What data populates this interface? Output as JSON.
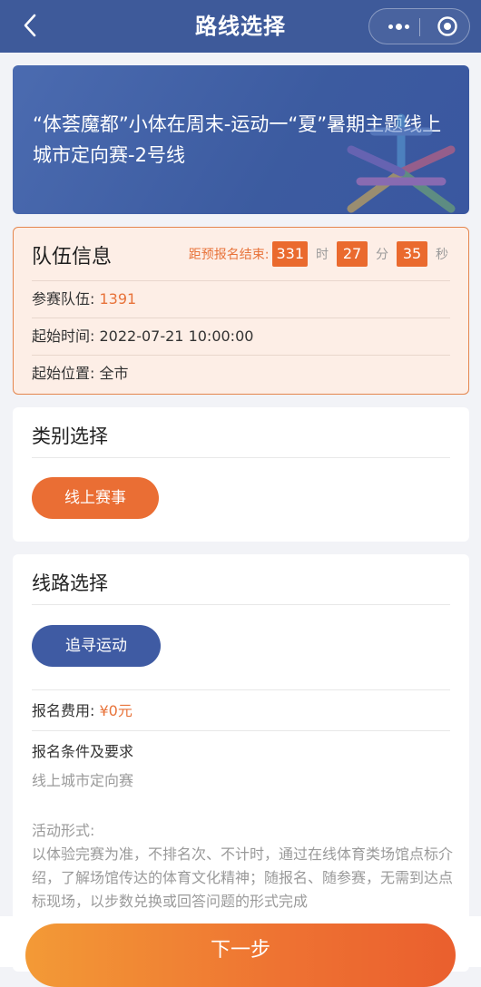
{
  "header": {
    "title": "路线选择"
  },
  "banner": {
    "title": "“体荟魔都”小体在周末-运动一“夏”暑期主题线上城市定向赛-2号线"
  },
  "team": {
    "title": "队伍信息",
    "countdown": {
      "label": "距预报名结束:",
      "hours": "331",
      "hours_unit": "时",
      "minutes": "27",
      "minutes_unit": "分",
      "seconds": "35",
      "seconds_unit": "秒"
    },
    "rows": [
      {
        "label": "参赛队伍:",
        "value": "1391"
      },
      {
        "label": "起始时间:",
        "value": "2022-07-21 10:00:00"
      },
      {
        "label": "起始位置:",
        "value": "全市"
      }
    ]
  },
  "category": {
    "title": "类别选择",
    "option": "线上赛事"
  },
  "route": {
    "title": "线路选择",
    "option": "追寻运动",
    "fee_label": "报名费用:",
    "fee_value": "¥0元",
    "req_title": "报名条件及要求",
    "req_text": "线上城市定向赛",
    "form_label": "活动形式:",
    "form_text": "以体验完赛为准，不排名次、不计时，通过在线体育类场馆点标介绍，了解场馆传达的体育文化精神；随报名、随参赛，无需到达点标现场，以步数兑换或回答问题的形式完成"
  },
  "footer": {
    "next_label": "下一步"
  },
  "colors": {
    "header": "#3e5a9a",
    "accent_orange": "#ea6e34",
    "accent_blue": "#3f5ba3"
  },
  "icons": [
    "back-arrow-icon",
    "more-dots-icon",
    "close-target-icon",
    "emblem-icon"
  ]
}
